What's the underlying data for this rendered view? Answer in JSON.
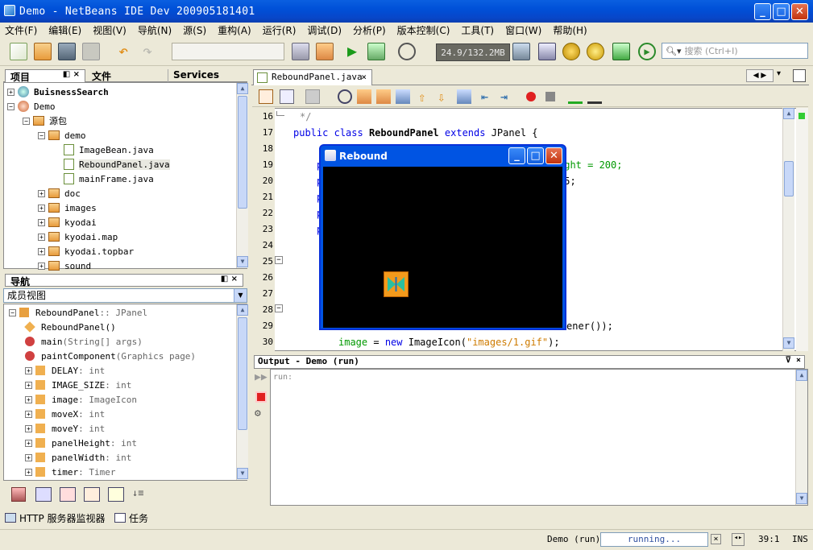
{
  "window": {
    "title": "Demo - NetBeans IDE Dev 200905181401",
    "controls": {
      "minimize": "_",
      "maximize": "□",
      "close": "✕"
    }
  },
  "menu": [
    "文件(F)",
    "编辑(E)",
    "视图(V)",
    "导航(N)",
    "源(S)",
    "重构(A)",
    "运行(R)",
    "调试(D)",
    "分析(P)",
    "版本控制(C)",
    "工具(T)",
    "窗口(W)",
    "帮助(H)"
  ],
  "toolbar": {
    "memory": "24.9/132.2MB",
    "search_placeholder": "搜索 (Ctrl+I)"
  },
  "projects_panel": {
    "tabs": [
      "项目",
      "文件",
      "Services"
    ],
    "tree": [
      {
        "label": "BuisnessSearch",
        "bold": true,
        "level": 0
      },
      {
        "label": "Demo",
        "level": 0
      },
      {
        "label": "源包",
        "level": 1
      },
      {
        "label": "demo",
        "level": 2
      },
      {
        "label": "ImageBean.java",
        "level": 3
      },
      {
        "label": "ReboundPanel.java",
        "level": 3
      },
      {
        "label": "mainFrame.java",
        "level": 3
      },
      {
        "label": "doc",
        "level": 2
      },
      {
        "label": "images",
        "level": 2
      },
      {
        "label": "kyodai",
        "level": 2
      },
      {
        "label": "kyodai.map",
        "level": 2
      },
      {
        "label": "kyodai.topbar",
        "level": 2
      },
      {
        "label": "sound",
        "level": 2
      }
    ]
  },
  "navigator_panel": {
    "title": "导航",
    "view_select": "成员视图",
    "members": [
      {
        "name": "ReboundPanel",
        "type": " :: JPanel"
      },
      {
        "name": "ReboundPanel()",
        "type": ""
      },
      {
        "name": "main",
        "type": "(String[] args)"
      },
      {
        "name": "paintComponent",
        "type": "(Graphics page)"
      },
      {
        "name": "DELAY",
        "type": " : int"
      },
      {
        "name": "IMAGE_SIZE",
        "type": " : int"
      },
      {
        "name": "image",
        "type": " : ImageIcon"
      },
      {
        "name": "moveX",
        "type": " : int"
      },
      {
        "name": "moveY",
        "type": " : int"
      },
      {
        "name": "panelHeight",
        "type": " : int"
      },
      {
        "name": "panelWidth",
        "type": " : int"
      },
      {
        "name": "timer",
        "type": " : Timer"
      }
    ]
  },
  "editor": {
    "tab": "ReboundPanel.java",
    "line_numbers": [
      "16",
      "17",
      "18",
      "19",
      "20",
      "21",
      "22",
      "23",
      "24",
      "25",
      "26",
      "27",
      "28",
      "29",
      "30"
    ],
    "comment_close": "*/",
    "class_kw1": "public",
    "class_kw2": "class",
    "class_name": "ReboundPanel",
    "extends_kw": "extends",
    "extends_rest": "JPanel {",
    "line19_frag": "ght = 200;",
    "line20_frag": "5;",
    "line29_frag": "ener());",
    "line30_field": "image",
    "line30_eq": " = ",
    "line30_new": "new",
    "line30_cls": " ImageIcon(",
    "line30_str": "\"images/1.gif\"",
    "line30_end": ");"
  },
  "rebound_window": {
    "title": "Rebound"
  },
  "output": {
    "title": "Output - Demo (run)",
    "text": "run:"
  },
  "bottom_tabs": [
    "HTTP 服务器监视器",
    "任务"
  ],
  "status": {
    "project": "Demo (run)",
    "progress_label": "running...",
    "position": "39:1",
    "mode": "INS"
  },
  "colors": {
    "keyword": "#0000e6",
    "string": "#ce7b00",
    "field": "#009900",
    "title_blue": "#0054e3"
  }
}
